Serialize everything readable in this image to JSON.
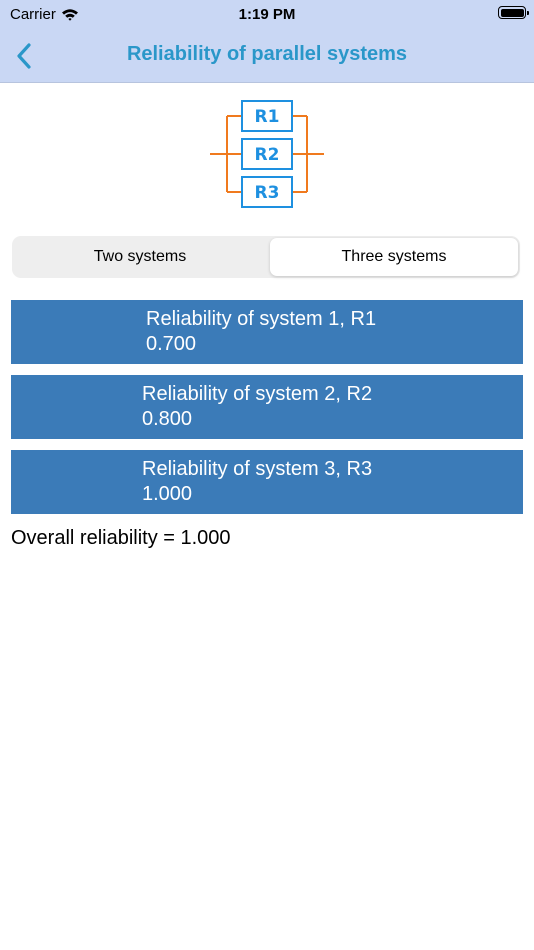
{
  "status_bar": {
    "carrier": "Carrier",
    "time": "1:19 PM"
  },
  "nav": {
    "title": "Reliability of parallel systems",
    "back_icon": "chevron-left-icon"
  },
  "diagram": {
    "labels": [
      "R1",
      "R2",
      "R3"
    ],
    "box_color": "#1e90e0",
    "line_color": "#f07a1e"
  },
  "segmented": {
    "two_label": "Two systems",
    "three_label": "Three systems",
    "selected": "three"
  },
  "systems": [
    {
      "label": "Reliability of system 1, R1",
      "value": "0.700"
    },
    {
      "label": "Reliability of system 2, R2",
      "value": "0.800"
    },
    {
      "label": "Reliability of system 3, R3",
      "value": "1.000"
    }
  ],
  "result": {
    "text": "Overall reliability = 1.000"
  },
  "colors": {
    "nav_background": "#c9d7f4",
    "title": "#2a97c9",
    "button_background": "#3b7bb8"
  }
}
